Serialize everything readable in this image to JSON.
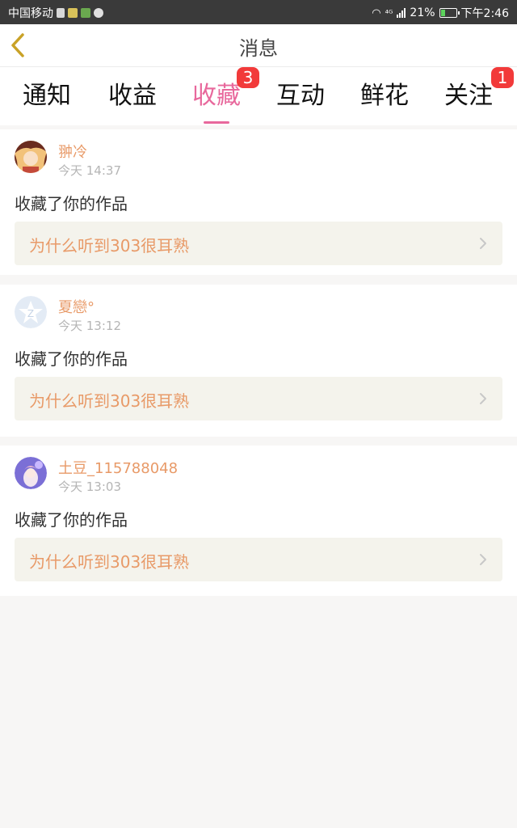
{
  "status_bar": {
    "carrier": "中国移动",
    "signal_label": "⁴ᴳ",
    "battery": "21%",
    "time": "下午2:46"
  },
  "header": {
    "title": "消息"
  },
  "tabs": [
    {
      "label": "通知",
      "badge": ""
    },
    {
      "label": "收益",
      "badge": ""
    },
    {
      "label": "收藏",
      "badge": "3",
      "active": true
    },
    {
      "label": "互动",
      "badge": ""
    },
    {
      "label": "鲜花",
      "badge": ""
    },
    {
      "label": "关注",
      "badge": "1"
    }
  ],
  "messages": [
    {
      "user": "翀冷",
      "time": "今天 14:37",
      "action": "收藏了你的作品",
      "work": "为什么听到303很耳熟"
    },
    {
      "user": "夏戀°",
      "time": "今天 13:12",
      "action": "收藏了你的作品",
      "work": "为什么听到303很耳熟"
    },
    {
      "user": "土豆_115788048",
      "time": "今天 13:03",
      "action": "收藏了你的作品",
      "work": "为什么听到303很耳熟"
    }
  ],
  "colors": {
    "accent": "#e8689c",
    "username": "#e89a68",
    "badge": "#f23a3a",
    "back_icon": "#c9a227"
  }
}
